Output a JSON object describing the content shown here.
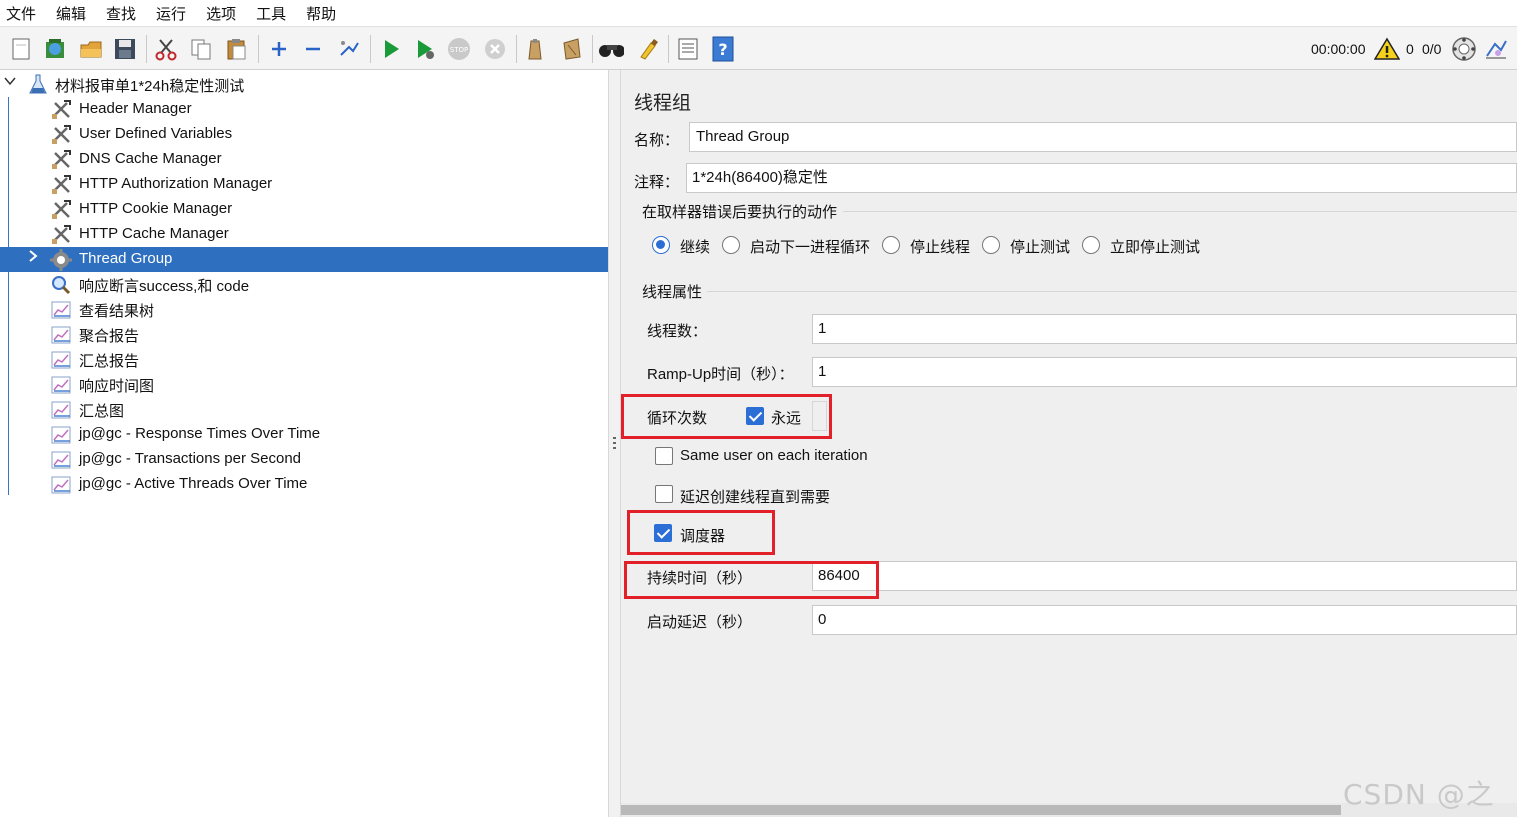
{
  "menu": [
    "文件",
    "编辑",
    "查找",
    "运行",
    "选项",
    "工具",
    "帮助"
  ],
  "toolbar_icons": [
    "new-file-icon",
    "templates-icon",
    "open-icon",
    "save-icon",
    "cut-icon",
    "copy-icon",
    "paste-icon",
    "expand-icon",
    "collapse-icon",
    "toggle-icon",
    "start-icon",
    "start-no-pause-icon",
    "stop-icon",
    "shutdown-icon",
    "clear-icon",
    "clear-all-icon",
    "search-icon",
    "reset-search-icon",
    "function-helper-icon",
    "help-icon"
  ],
  "status": {
    "elapsed_time": "00:00:00",
    "error_count": "0",
    "active_threads": "0/0"
  },
  "tree": {
    "root_label": "材料报审单1*24h稳定性测试",
    "items": [
      {
        "label": "Header Manager",
        "icon": "config-element-icon",
        "selected": false
      },
      {
        "label": "User Defined Variables",
        "icon": "config-element-icon",
        "selected": false
      },
      {
        "label": "DNS Cache Manager",
        "icon": "config-element-icon",
        "selected": false
      },
      {
        "label": "HTTP Authorization Manager",
        "icon": "config-element-icon",
        "selected": false
      },
      {
        "label": "HTTP Cookie Manager",
        "icon": "config-element-icon",
        "selected": false
      },
      {
        "label": "HTTP Cache Manager",
        "icon": "config-element-icon",
        "selected": false
      },
      {
        "label": "Thread Group",
        "icon": "thread-group-gear-icon",
        "selected": true
      },
      {
        "label": "响应断言success,和 code",
        "icon": "assertion-magnifier-icon",
        "selected": false
      },
      {
        "label": "查看结果树",
        "icon": "listener-chart-icon",
        "selected": false
      },
      {
        "label": "聚合报告",
        "icon": "listener-chart-icon",
        "selected": false
      },
      {
        "label": "汇总报告",
        "icon": "listener-chart-icon",
        "selected": false
      },
      {
        "label": "响应时间图",
        "icon": "listener-chart-icon",
        "selected": false
      },
      {
        "label": "汇总图",
        "icon": "listener-chart-icon",
        "selected": false
      },
      {
        "label": "jp@gc - Response Times Over Time",
        "icon": "listener-chart-icon",
        "selected": false
      },
      {
        "label": "jp@gc - Transactions per Second",
        "icon": "listener-chart-icon",
        "selected": false
      },
      {
        "label": "jp@gc - Active Threads Over Time",
        "icon": "listener-chart-icon",
        "selected": false
      }
    ]
  },
  "form": {
    "title": "线程组",
    "name_label": "名称：",
    "name_value": "Thread Group",
    "comment_label": "注释：",
    "comment_value": "1*24h(86400)稳定性",
    "on_error": {
      "group_title": "在取样器错误后要执行的动作",
      "options": [
        "继续",
        "启动下一进程循环",
        "停止线程",
        "停止测试",
        "立即停止测试"
      ],
      "selected_index": 0
    },
    "thread_props": {
      "group_title": "线程属性",
      "threads_label": "线程数：",
      "threads_value": "1",
      "rampup_label": "Ramp-Up时间（秒）：",
      "rampup_value": "1",
      "loop_label": "循环次数",
      "forever_label": "永远",
      "forever_checked": true,
      "same_user_label": "Same user on each iteration",
      "same_user_checked": false,
      "delay_create_label": "延迟创建线程直到需要",
      "delay_create_checked": false,
      "scheduler_label": "调度器",
      "scheduler_checked": true,
      "duration_label": "持续时间（秒）",
      "duration_value": "86400",
      "startup_delay_label": "启动延迟（秒）",
      "startup_delay_value": "0"
    }
  },
  "highlight_color": "#e2202a",
  "selection_color": "#2f6fbf",
  "watermark": "CSDN @之岛"
}
